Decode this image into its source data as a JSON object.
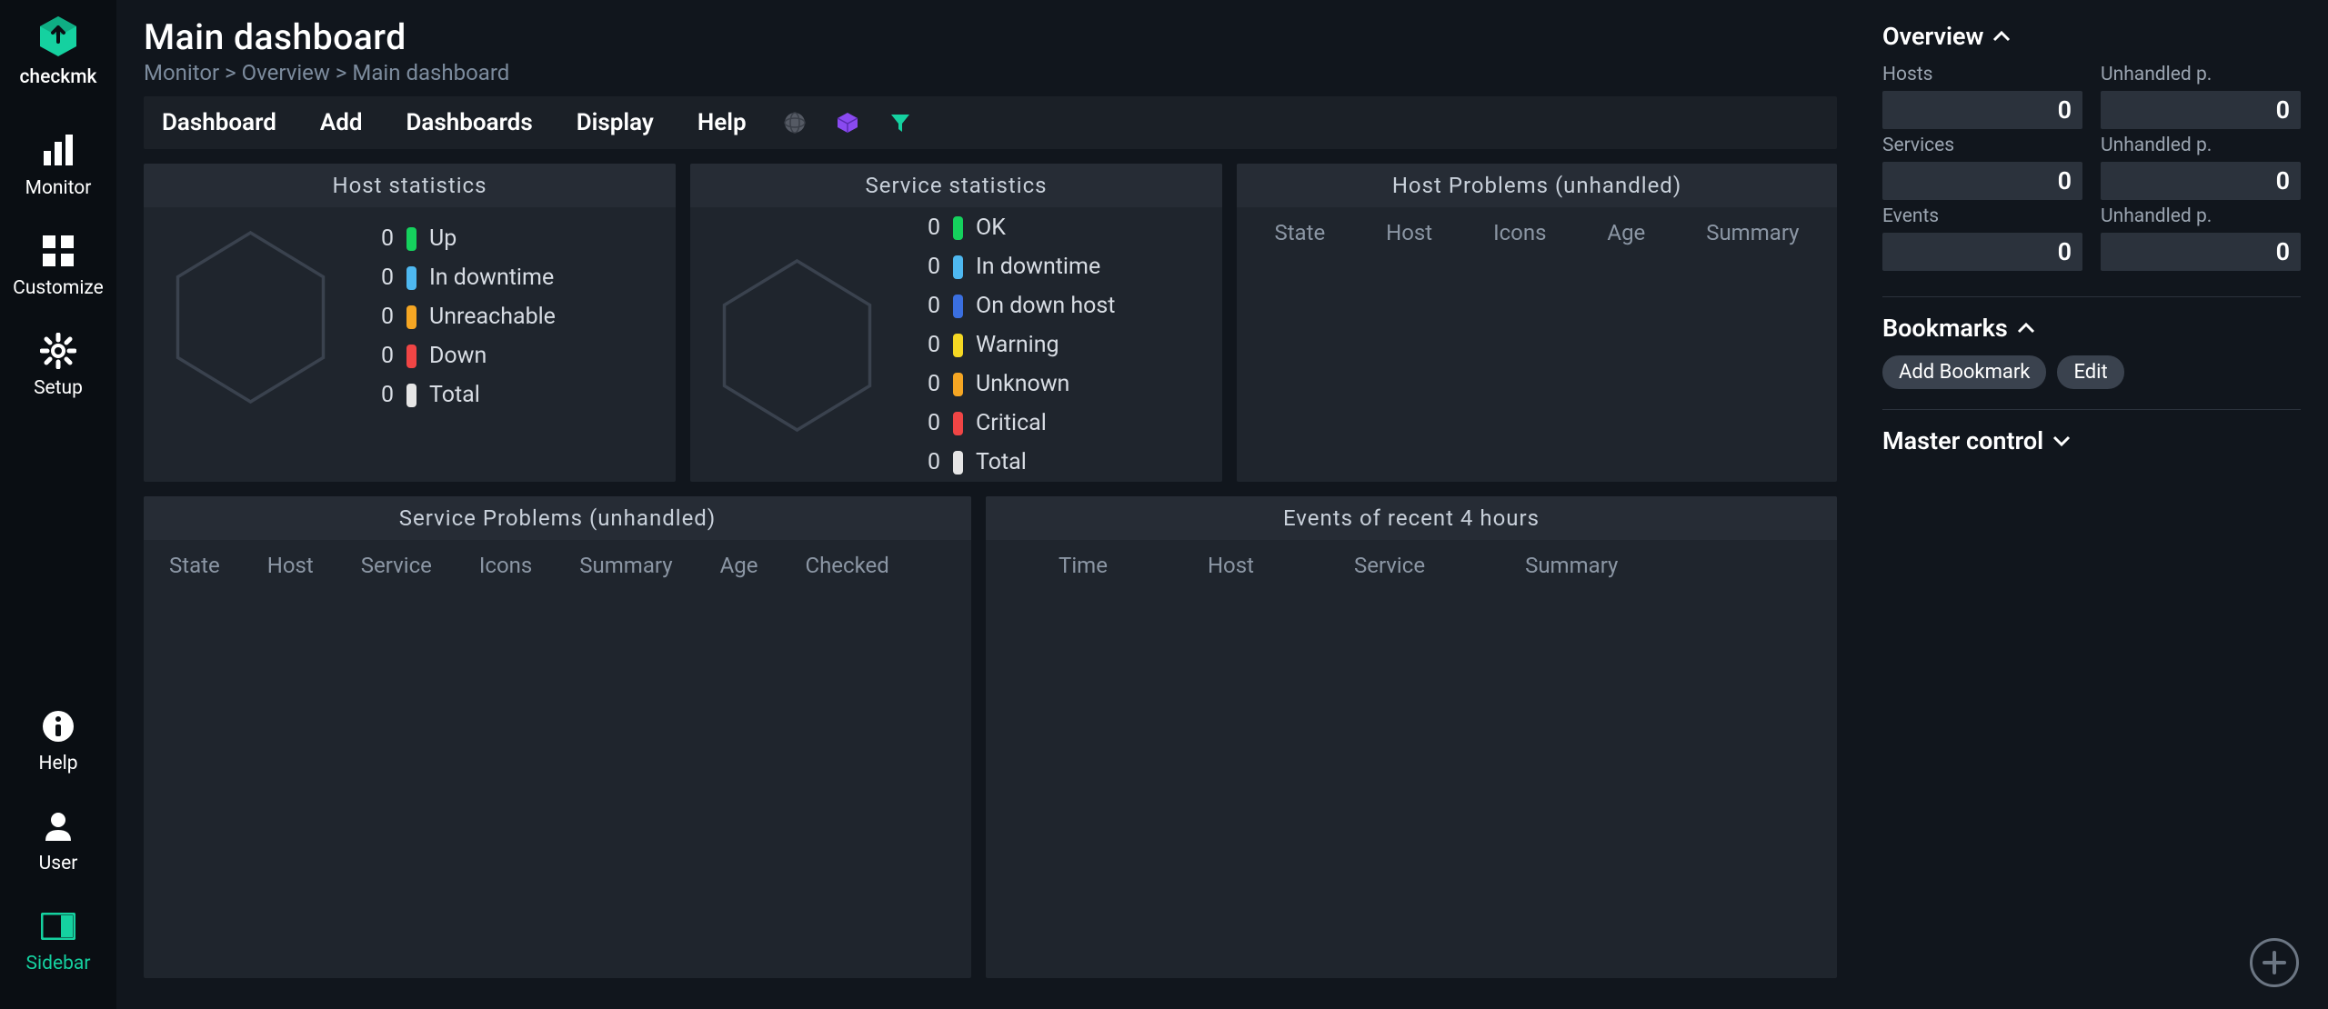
{
  "brand": "checkmk",
  "colors": {
    "accent": "#15d1a0",
    "green": "#15d15d",
    "ltblue": "#4eb8f0",
    "blue": "#3a6fe0",
    "orange": "#f5a623",
    "red": "#f04545",
    "white": "#e6e6e6",
    "yellow": "#f5d823",
    "purple": "#8a4af0"
  },
  "nav": {
    "monitor": "Monitor",
    "customize": "Customize",
    "setup": "Setup",
    "help": "Help",
    "user": "User",
    "sidebar": "Sidebar"
  },
  "header": {
    "title": "Main dashboard",
    "crumb1": "Monitor",
    "crumb2": "Overview",
    "crumb3": "Main dashboard"
  },
  "menu": {
    "dashboard": "Dashboard",
    "add": "Add",
    "dashboards": "Dashboards",
    "display": "Display",
    "help": "Help"
  },
  "hostStats": {
    "title": "Host statistics",
    "items": [
      {
        "count": "0",
        "color": "#15d15d",
        "label": "Up"
      },
      {
        "count": "0",
        "color": "#4eb8f0",
        "label": "In downtime"
      },
      {
        "count": "0",
        "color": "#f5a623",
        "label": "Unreachable"
      },
      {
        "count": "0",
        "color": "#f04545",
        "label": "Down"
      },
      {
        "count": "0",
        "color": "#e6e6e6",
        "label": "Total"
      }
    ]
  },
  "serviceStats": {
    "title": "Service statistics",
    "items": [
      {
        "count": "0",
        "color": "#15d15d",
        "label": "OK"
      },
      {
        "count": "0",
        "color": "#4eb8f0",
        "label": "In downtime"
      },
      {
        "count": "0",
        "color": "#3a6fe0",
        "label": "On down host"
      },
      {
        "count": "0",
        "color": "#f5d823",
        "label": "Warning"
      },
      {
        "count": "0",
        "color": "#f5a623",
        "label": "Unknown"
      },
      {
        "count": "0",
        "color": "#f04545",
        "label": "Critical"
      },
      {
        "count": "0",
        "color": "#e6e6e6",
        "label": "Total"
      }
    ]
  },
  "hostProblems": {
    "title": "Host Problems (unhandled)",
    "cols": [
      "State",
      "Host",
      "Icons",
      "Age",
      "Summary"
    ]
  },
  "serviceProblems": {
    "title": "Service Problems (unhandled)",
    "cols": [
      "State",
      "Host",
      "Service",
      "Icons",
      "Summary",
      "Age",
      "Checked"
    ]
  },
  "events": {
    "title": "Events of recent 4 hours",
    "cols": [
      "Time",
      "Host",
      "Service",
      "Summary"
    ]
  },
  "right": {
    "overview": {
      "title": "Overview",
      "hosts_lbl": "Hosts",
      "hosts_val": "0",
      "hosts_unh_lbl": "Unhandled p.",
      "hosts_unh_val": "0",
      "services_lbl": "Services",
      "services_val": "0",
      "services_unh_lbl": "Unhandled p.",
      "services_unh_val": "0",
      "events_lbl": "Events",
      "events_val": "0",
      "events_unh_lbl": "Unhandled p.",
      "events_unh_val": "0"
    },
    "bookmarks": {
      "title": "Bookmarks",
      "add": "Add Bookmark",
      "edit": "Edit"
    },
    "master": {
      "title": "Master control"
    }
  }
}
